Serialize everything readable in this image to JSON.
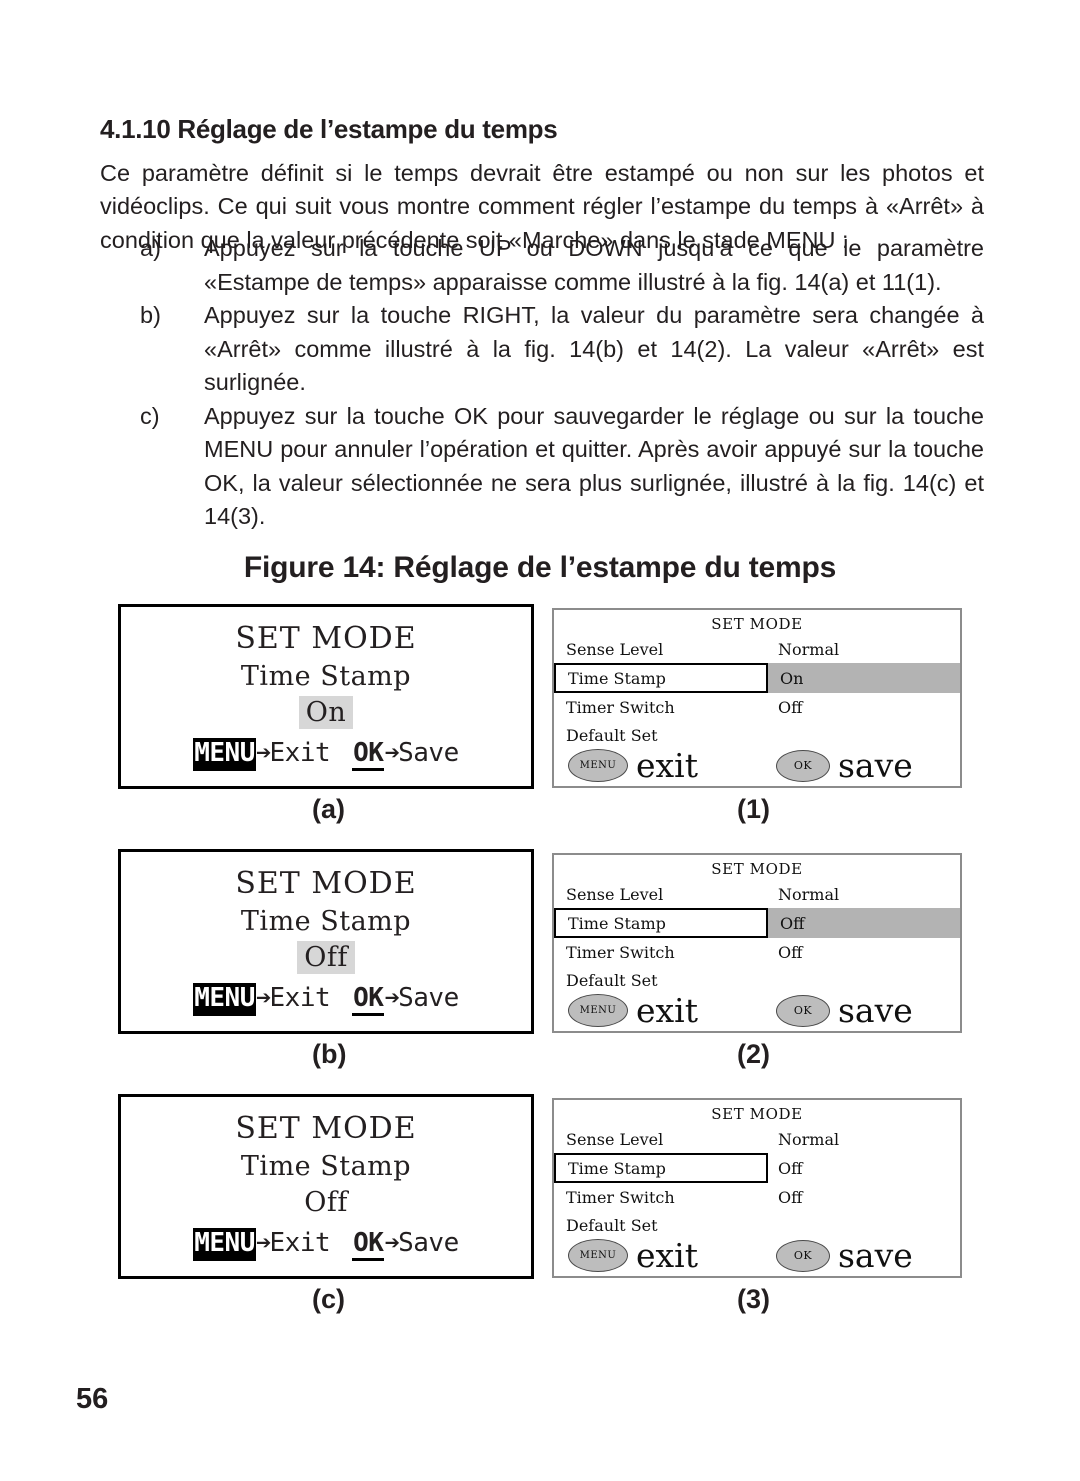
{
  "section": {
    "heading": "4.1.10 Réglage de l’estampe du temps",
    "intro": "Ce paramètre définit si le temps devrait être estampé ou non sur les photos et vidéoclips.  Ce qui suit vous montre comment régler l’estampe du temps à «Arrêt» à condition que la valeur précédente soit «Marche» dans le stade MENU :",
    "steps": [
      {
        "marker": "a)",
        "text": "Appuyez sur la touche UP ou DOWN jusqu’à ce que le paramètre «Estampe de temps» apparaisse comme illustré à la fig. 14(a) et 11(1)."
      },
      {
        "marker": "b)",
        "text": "Appuyez sur la touche RIGHT, la valeur du paramètre sera changée à «Arrêt» comme illustré à la fig. 14(b) et 14(2). La valeur «Arrêt» est surlignée."
      },
      {
        "marker": "c)",
        "text": "Appuyez sur la touche OK pour sauvegarder le réglage ou sur la touche MENU pour annuler l’opération et quitter.  Après avoir appuyé sur la touche OK, la valeur sélectionnée ne sera plus surlignée, illustré à la fig. 14(c) et 14(3)."
      }
    ]
  },
  "figure": {
    "caption": "Figure 14: Réglage de l’estampe du temps",
    "rows": [
      {
        "left_label": "(a)",
        "right_label": "(1)",
        "lcd": {
          "title": "SET MODE",
          "param": "Time Stamp",
          "value": "On",
          "value_highlighted": true,
          "hint_menu_key": "MENU",
          "hint_menu_action": "Exit",
          "hint_ok_key": "OK",
          "hint_ok_action": "Save",
          "arrow": "➔"
        },
        "menu": {
          "title": "SET MODE",
          "rows": [
            {
              "label": "Sense Level",
              "value": "Normal",
              "selected": false,
              "value_highlighted": false
            },
            {
              "label": "Time Stamp",
              "value": "On",
              "selected": true,
              "value_highlighted": true
            },
            {
              "label": "Timer Switch",
              "value": "Off",
              "selected": false,
              "value_highlighted": false
            },
            {
              "label": "Default Set",
              "value": "",
              "selected": false,
              "value_highlighted": false
            }
          ],
          "exit_button": "MENU",
          "exit_label": "exit",
          "save_button": "OK",
          "save_label": "save"
        }
      },
      {
        "left_label": "(b)",
        "right_label": "(2)",
        "lcd": {
          "title": "SET MODE",
          "param": "Time Stamp",
          "value": "Off",
          "value_highlighted": true,
          "hint_menu_key": "MENU",
          "hint_menu_action": "Exit",
          "hint_ok_key": "OK",
          "hint_ok_action": "Save",
          "arrow": "➔"
        },
        "menu": {
          "title": "SET MODE",
          "rows": [
            {
              "label": "Sense Level",
              "value": "Normal",
              "selected": false,
              "value_highlighted": false
            },
            {
              "label": "Time Stamp",
              "value": "Off",
              "selected": true,
              "value_highlighted": true
            },
            {
              "label": "Timer Switch",
              "value": "Off",
              "selected": false,
              "value_highlighted": false
            },
            {
              "label": "Default Set",
              "value": "",
              "selected": false,
              "value_highlighted": false
            }
          ],
          "exit_button": "MENU",
          "exit_label": "exit",
          "save_button": "OK",
          "save_label": "save"
        }
      },
      {
        "left_label": "(c)",
        "right_label": "(3)",
        "lcd": {
          "title": "SET MODE",
          "param": "Time Stamp",
          "value": "Off",
          "value_highlighted": false,
          "hint_menu_key": "MENU",
          "hint_menu_action": "Exit",
          "hint_ok_key": "OK",
          "hint_ok_action": "Save",
          "arrow": "➔"
        },
        "menu": {
          "title": "SET MODE",
          "rows": [
            {
              "label": "Sense Level",
              "value": "Normal",
              "selected": false,
              "value_highlighted": false
            },
            {
              "label": "Time Stamp",
              "value": "Off",
              "selected": true,
              "value_highlighted": false
            },
            {
              "label": "Timer Switch",
              "value": "Off",
              "selected": false,
              "value_highlighted": false
            },
            {
              "label": "Default Set",
              "value": "",
              "selected": false,
              "value_highlighted": false
            }
          ],
          "exit_button": "MENU",
          "exit_label": "exit",
          "save_button": "OK",
          "save_label": "save"
        }
      }
    ]
  },
  "footer": {
    "page_number": "56"
  }
}
